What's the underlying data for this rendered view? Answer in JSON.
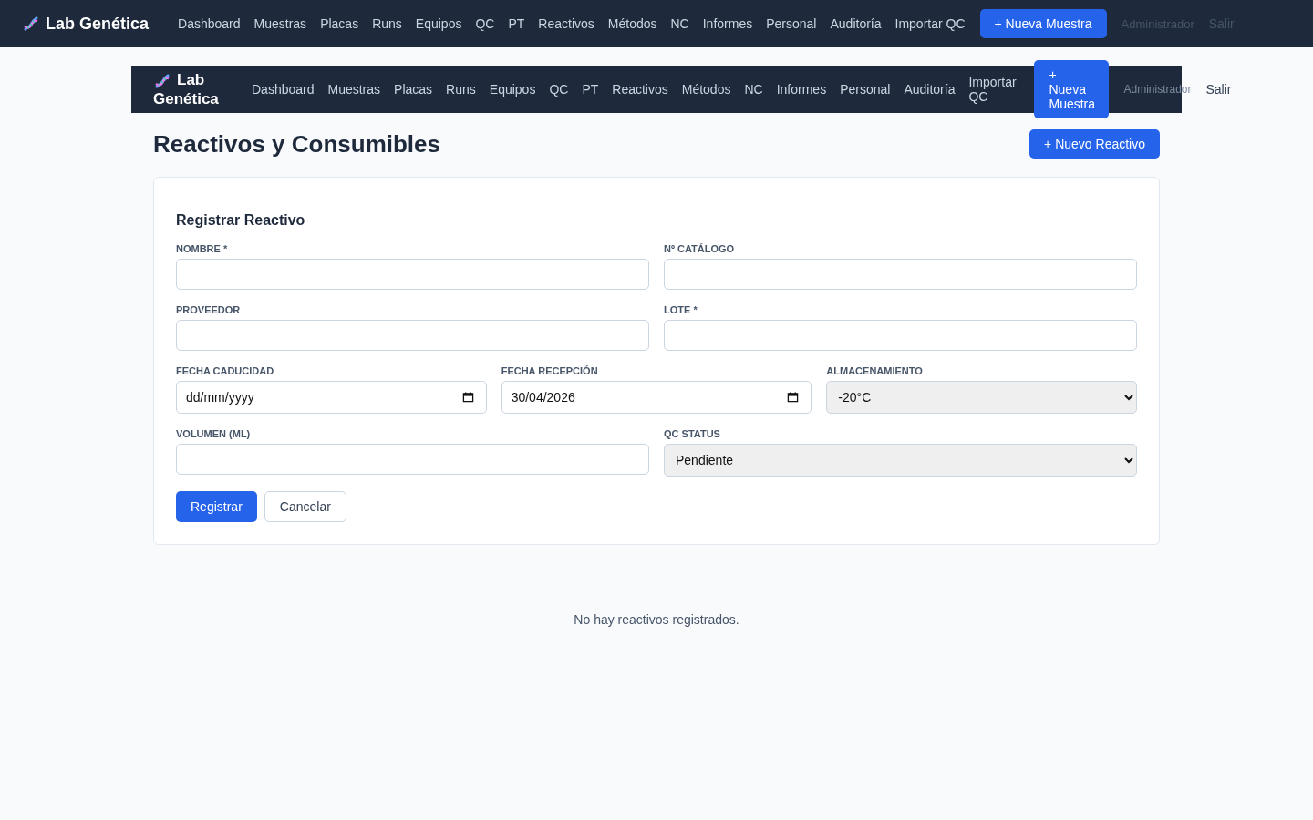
{
  "top_nav": {
    "brand": "Lab Genética",
    "links": [
      {
        "label": "Dashboard",
        "selected": false
      },
      {
        "label": "Muestras",
        "selected": false
      },
      {
        "label": "Placas",
        "selected": false
      },
      {
        "label": "Runs",
        "selected": false
      },
      {
        "label": "Equipos",
        "selected": false
      },
      {
        "label": "QC",
        "selected": false
      },
      {
        "label": "PT",
        "selected": false
      },
      {
        "label": "Reactivos",
        "selected": false
      },
      {
        "label": "Métodos",
        "selected": false
      },
      {
        "label": "NC",
        "selected": false
      },
      {
        "label": "Informes",
        "selected": false
      },
      {
        "label": "Personal",
        "selected": false
      },
      {
        "label": "Auditoría",
        "selected": false
      },
      {
        "label": "Importar QC",
        "selected": false
      }
    ],
    "action": "+ Nueva Muestra",
    "user": "Administrador",
    "logout": "Salir"
  },
  "inner_nav": {
    "brand": "Lab Genética",
    "links": [
      {
        "label": "Dashboard",
        "selected": false
      },
      {
        "label": "Muestras",
        "selected": false
      },
      {
        "label": "Placas",
        "selected": false
      },
      {
        "label": "Runs",
        "selected": false
      },
      {
        "label": "Equipos",
        "selected": false
      },
      {
        "label": "QC",
        "selected": false
      },
      {
        "label": "PT",
        "selected": false
      },
      {
        "label": "Reactivos",
        "selected": false
      },
      {
        "label": "Métodos",
        "selected": false
      },
      {
        "label": "NC",
        "selected": false
      },
      {
        "label": "Informes",
        "selected": false
      },
      {
        "label": "Personal",
        "selected": false
      },
      {
        "label": "Auditoría",
        "selected": false
      },
      {
        "label": "Importar QC",
        "selected": false
      }
    ],
    "action": "+ Nueva Muestra",
    "user": "Administrador",
    "logout": "Salir"
  },
  "page": {
    "title": "Reactivos y Consumibles",
    "action": "+ Nuevo Reactivo"
  },
  "form": {
    "title": "Registrar Reactivo",
    "rows": [
      [
        {
          "kind": "text",
          "label": "NOMBRE *"
        },
        {
          "kind": "text",
          "label": "Nº CATÁLOGO"
        }
      ],
      [
        {
          "kind": "text",
          "label": "PROVEEDOR"
        },
        {
          "kind": "text",
          "label": "LOTE *"
        }
      ],
      [
        {
          "kind": "date",
          "label": "FECHA CADUCIDAD",
          "placeholder": "dd/mm/yyyy"
        },
        {
          "kind": "date",
          "label": "FECHA RECEPCIÓN",
          "value": "30/04/2026"
        },
        {
          "kind": "select",
          "label": "ALMACENAMIENTO",
          "value": "-20°C"
        }
      ],
      [
        {
          "kind": "text",
          "label": "VOLUMEN (ML)"
        },
        {
          "kind": "select",
          "label": "QC STATUS",
          "value": "Pendiente"
        }
      ]
    ],
    "submit": "Registrar",
    "cancel": "Cancelar"
  },
  "empty_message": "No hay reactivos registrados."
}
